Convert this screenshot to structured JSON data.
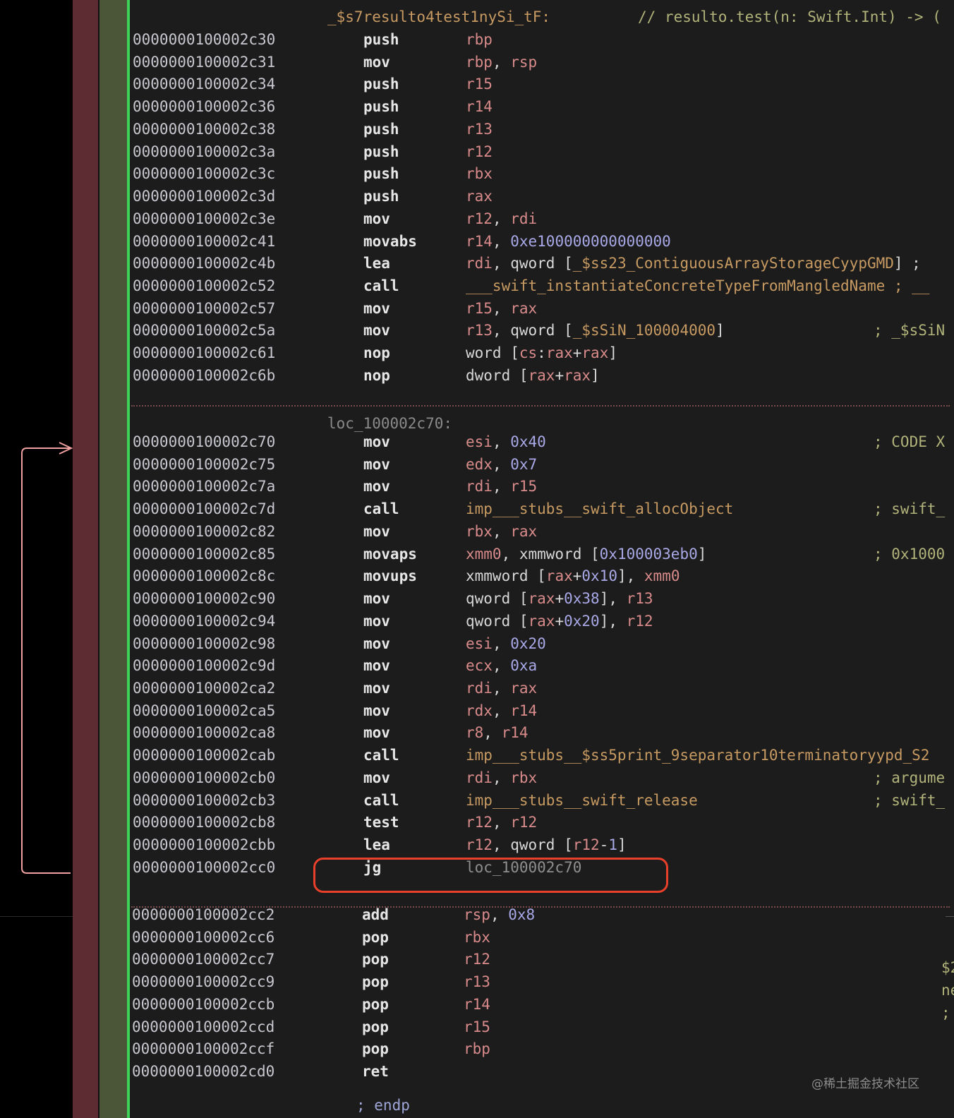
{
  "function": {
    "label": "_$s7resulto4test1nySi_tF:",
    "comment": "// resulto.test(n: Swift.Int) -> ("
  },
  "block1": [
    {
      "addr": "0000000100002c30",
      "mnem": "push",
      "ops": [
        [
          "rbp",
          "reg"
        ]
      ],
      "cmt": ""
    },
    {
      "addr": "0000000100002c31",
      "mnem": "mov",
      "ops": [
        [
          "rbp",
          "reg"
        ],
        [
          ", ",
          "punc"
        ],
        [
          "rsp",
          "reg"
        ]
      ],
      "cmt": ""
    },
    {
      "addr": "0000000100002c34",
      "mnem": "push",
      "ops": [
        [
          "r15",
          "reg"
        ]
      ],
      "cmt": ""
    },
    {
      "addr": "0000000100002c36",
      "mnem": "push",
      "ops": [
        [
          "r14",
          "reg"
        ]
      ],
      "cmt": ""
    },
    {
      "addr": "0000000100002c38",
      "mnem": "push",
      "ops": [
        [
          "r13",
          "reg"
        ]
      ],
      "cmt": ""
    },
    {
      "addr": "0000000100002c3a",
      "mnem": "push",
      "ops": [
        [
          "r12",
          "reg"
        ]
      ],
      "cmt": ""
    },
    {
      "addr": "0000000100002c3c",
      "mnem": "push",
      "ops": [
        [
          "rbx",
          "reg"
        ]
      ],
      "cmt": ""
    },
    {
      "addr": "0000000100002c3d",
      "mnem": "push",
      "ops": [
        [
          "rax",
          "reg"
        ]
      ],
      "cmt": ""
    },
    {
      "addr": "0000000100002c3e",
      "mnem": "mov",
      "ops": [
        [
          "r12",
          "reg"
        ],
        [
          ", ",
          "punc"
        ],
        [
          "rdi",
          "reg"
        ]
      ],
      "cmt": ""
    },
    {
      "addr": "0000000100002c41",
      "mnem": "movabs",
      "ops": [
        [
          "r14",
          "reg"
        ],
        [
          ", ",
          "punc"
        ],
        [
          "0xe100000000000000",
          "num"
        ]
      ],
      "cmt": ""
    },
    {
      "addr": "0000000100002c4b",
      "mnem": "lea",
      "ops": [
        [
          "rdi",
          "reg"
        ],
        [
          ", qword [",
          "kw"
        ],
        [
          "_$ss23_ContiguousArrayStorageCyypGMD",
          "sym"
        ],
        [
          "] ;",
          "punc"
        ]
      ],
      "cmt": ""
    },
    {
      "addr": "0000000100002c52",
      "mnem": "call",
      "ops": [
        [
          "___swift_instantiateConcreteTypeFromMangledName ; __",
          "sym"
        ]
      ],
      "cmt": ""
    },
    {
      "addr": "0000000100002c57",
      "mnem": "mov",
      "ops": [
        [
          "r15",
          "reg"
        ],
        [
          ", ",
          "punc"
        ],
        [
          "rax",
          "reg"
        ]
      ],
      "cmt": ""
    },
    {
      "addr": "0000000100002c5a",
      "mnem": "mov",
      "ops": [
        [
          "r13",
          "reg"
        ],
        [
          ", qword [",
          "kw"
        ],
        [
          "_$sSiN_100004000",
          "sym"
        ],
        [
          "]",
          "punc"
        ]
      ],
      "cmt": "; _$sSiN"
    },
    {
      "addr": "0000000100002c61",
      "mnem": "nop",
      "ops": [
        [
          "word [",
          "kw"
        ],
        [
          "cs",
          "reg"
        ],
        [
          ":",
          "punc"
        ],
        [
          "rax",
          "reg"
        ],
        [
          "+",
          "punc"
        ],
        [
          "rax",
          "reg"
        ],
        [
          "]",
          "punc"
        ]
      ],
      "cmt": ""
    },
    {
      "addr": "0000000100002c6b",
      "mnem": "nop",
      "ops": [
        [
          "dword [",
          "kw"
        ],
        [
          "rax",
          "reg"
        ],
        [
          "+",
          "punc"
        ],
        [
          "rax",
          "reg"
        ],
        [
          "]",
          "punc"
        ]
      ],
      "cmt": ""
    }
  ],
  "loop_label": "loc_100002c70:",
  "block2": [
    {
      "addr": "0000000100002c70",
      "mnem": "mov",
      "ops": [
        [
          "esi",
          "reg"
        ],
        [
          ", ",
          "punc"
        ],
        [
          "0x40",
          "num"
        ]
      ],
      "cmt": "; CODE X"
    },
    {
      "addr": "0000000100002c75",
      "mnem": "mov",
      "ops": [
        [
          "edx",
          "reg"
        ],
        [
          ", ",
          "punc"
        ],
        [
          "0x7",
          "num"
        ]
      ],
      "cmt": ""
    },
    {
      "addr": "0000000100002c7a",
      "mnem": "mov",
      "ops": [
        [
          "rdi",
          "reg"
        ],
        [
          ", ",
          "punc"
        ],
        [
          "r15",
          "reg"
        ]
      ],
      "cmt": ""
    },
    {
      "addr": "0000000100002c7d",
      "mnem": "call",
      "ops": [
        [
          "imp___stubs__swift_allocObject",
          "sym"
        ]
      ],
      "cmt": "; swift_"
    },
    {
      "addr": "0000000100002c82",
      "mnem": "mov",
      "ops": [
        [
          "rbx",
          "reg"
        ],
        [
          ", ",
          "punc"
        ],
        [
          "rax",
          "reg"
        ]
      ],
      "cmt": ""
    },
    {
      "addr": "0000000100002c85",
      "mnem": "movaps",
      "ops": [
        [
          "xmm0",
          "reg"
        ],
        [
          ", xmmword [",
          "kw"
        ],
        [
          "0x100003eb0",
          "num"
        ],
        [
          "]",
          "punc"
        ]
      ],
      "cmt": "; 0x1000"
    },
    {
      "addr": "0000000100002c8c",
      "mnem": "movups",
      "ops": [
        [
          "xmmword [",
          "kw"
        ],
        [
          "rax",
          "reg"
        ],
        [
          "+",
          "punc"
        ],
        [
          "0x10",
          "num"
        ],
        [
          "], ",
          "punc"
        ],
        [
          "xmm0",
          "reg"
        ]
      ],
      "cmt": ""
    },
    {
      "addr": "0000000100002c90",
      "mnem": "mov",
      "ops": [
        [
          "qword [",
          "kw"
        ],
        [
          "rax",
          "reg"
        ],
        [
          "+",
          "punc"
        ],
        [
          "0x38",
          "num"
        ],
        [
          "], ",
          "punc"
        ],
        [
          "r13",
          "reg"
        ]
      ],
      "cmt": ""
    },
    {
      "addr": "0000000100002c94",
      "mnem": "mov",
      "ops": [
        [
          "qword [",
          "kw"
        ],
        [
          "rax",
          "reg"
        ],
        [
          "+",
          "punc"
        ],
        [
          "0x20",
          "num"
        ],
        [
          "], ",
          "punc"
        ],
        [
          "r12",
          "reg"
        ]
      ],
      "cmt": ""
    },
    {
      "addr": "0000000100002c98",
      "mnem": "mov",
      "ops": [
        [
          "esi",
          "reg"
        ],
        [
          ", ",
          "punc"
        ],
        [
          "0x20",
          "num"
        ]
      ],
      "cmt": ""
    },
    {
      "addr": "0000000100002c9d",
      "mnem": "mov",
      "ops": [
        [
          "ecx",
          "reg"
        ],
        [
          ", ",
          "punc"
        ],
        [
          "0xa",
          "num"
        ]
      ],
      "cmt": ""
    },
    {
      "addr": "0000000100002ca2",
      "mnem": "mov",
      "ops": [
        [
          "rdi",
          "reg"
        ],
        [
          ", ",
          "punc"
        ],
        [
          "rax",
          "reg"
        ]
      ],
      "cmt": ""
    },
    {
      "addr": "0000000100002ca5",
      "mnem": "mov",
      "ops": [
        [
          "rdx",
          "reg"
        ],
        [
          ", ",
          "punc"
        ],
        [
          "r14",
          "reg"
        ]
      ],
      "cmt": ""
    },
    {
      "addr": "0000000100002ca8",
      "mnem": "mov",
      "ops": [
        [
          "r8",
          "reg"
        ],
        [
          ", ",
          "punc"
        ],
        [
          "r14",
          "reg"
        ]
      ],
      "cmt": ""
    },
    {
      "addr": "0000000100002cab",
      "mnem": "call",
      "ops": [
        [
          "imp___stubs__$ss5print_9separator10terminatoryypd_S2",
          "sym"
        ]
      ],
      "cmt": ""
    },
    {
      "addr": "0000000100002cb0",
      "mnem": "mov",
      "ops": [
        [
          "rdi",
          "reg"
        ],
        [
          ", ",
          "punc"
        ],
        [
          "rbx",
          "reg"
        ]
      ],
      "cmt": "; argume"
    },
    {
      "addr": "0000000100002cb3",
      "mnem": "call",
      "ops": [
        [
          "imp___stubs__swift_release",
          "sym"
        ]
      ],
      "cmt": "; swift_"
    },
    {
      "addr": "0000000100002cb8",
      "mnem": "test",
      "ops": [
        [
          "r12",
          "reg"
        ],
        [
          ", ",
          "punc"
        ],
        [
          "r12",
          "reg"
        ]
      ],
      "cmt": ""
    },
    {
      "addr": "0000000100002cbb",
      "mnem": "lea",
      "ops": [
        [
          "r12",
          "reg"
        ],
        [
          ", qword [",
          "kw"
        ],
        [
          "r12",
          "reg"
        ],
        [
          "-",
          "punc"
        ],
        [
          "1",
          "num"
        ],
        [
          "]",
          "punc"
        ]
      ],
      "cmt": ""
    },
    {
      "addr": "0000000100002cc0",
      "mnem": "jg",
      "ops": [
        [
          "loc_100002c70",
          "lbl"
        ]
      ],
      "cmt": ""
    }
  ],
  "block3": [
    {
      "addr": "0000000100002cc2",
      "mnem": "add",
      "ops": [
        [
          "rsp",
          "reg"
        ],
        [
          ", ",
          "punc"
        ],
        [
          "0x8",
          "num"
        ]
      ],
      "cmt": ""
    },
    {
      "addr": "0000000100002cc6",
      "mnem": "pop",
      "ops": [
        [
          "rbx",
          "reg"
        ]
      ],
      "cmt": ""
    },
    {
      "addr": "0000000100002cc7",
      "mnem": "pop",
      "ops": [
        [
          "r12",
          "reg"
        ]
      ],
      "cmt": ""
    },
    {
      "addr": "0000000100002cc9",
      "mnem": "pop",
      "ops": [
        [
          "r13",
          "reg"
        ]
      ],
      "cmt": ""
    },
    {
      "addr": "0000000100002ccb",
      "mnem": "pop",
      "ops": [
        [
          "r14",
          "reg"
        ]
      ],
      "cmt": ""
    },
    {
      "addr": "0000000100002ccd",
      "mnem": "pop",
      "ops": [
        [
          "r15",
          "reg"
        ]
      ],
      "cmt": ""
    },
    {
      "addr": "0000000100002ccf",
      "mnem": "pop",
      "ops": [
        [
          "rbp",
          "reg"
        ]
      ],
      "cmt": ""
    },
    {
      "addr": "0000000100002cd0",
      "mnem": "ret",
      "ops": [],
      "cmt": ""
    }
  ],
  "end_comment": "; endp",
  "right_fragments": [
    "$2",
    "ne",
    ";"
  ],
  "watermark": "@稀土掘金技术社区",
  "colors": {
    "gutter_red": "#5c2c32",
    "gutter_olive": "#4b5538",
    "green_line": "#3fd35a",
    "highlight": "#e8402a",
    "register": "#d98b8b",
    "number": "#a9a9e8",
    "symbol": "#c79a62",
    "comment": "#b1b37a"
  }
}
